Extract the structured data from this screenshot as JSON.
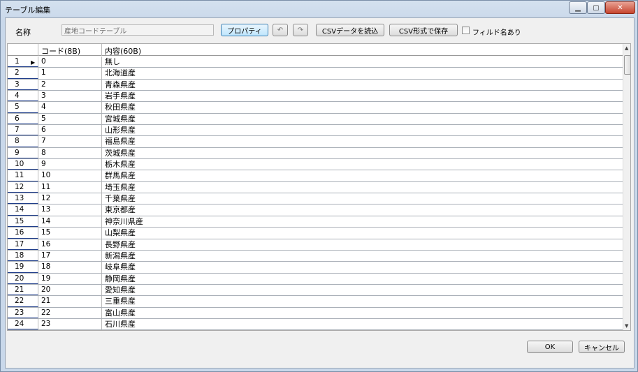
{
  "window": {
    "title": "テーブル編集"
  },
  "toolbar": {
    "name_label": "名称",
    "name_value": "産地コードテーブル",
    "property_label": "プロパティ",
    "undo_glyph": "↶",
    "redo_glyph": "↷",
    "csv_load_label": "CSVデータを読込",
    "csv_save_label": "CSV形式で保存",
    "field_names_label": "フィルド名あり",
    "field_names_checked": false
  },
  "grid": {
    "columns": [
      "コード(8B)",
      "内容(60B)"
    ],
    "rows": [
      {
        "num": "1",
        "code": "0",
        "content": "無し",
        "current": true
      },
      {
        "num": "2",
        "code": "1",
        "content": "北海道産"
      },
      {
        "num": "3",
        "code": "2",
        "content": "青森県産"
      },
      {
        "num": "4",
        "code": "3",
        "content": "岩手県産"
      },
      {
        "num": "5",
        "code": "4",
        "content": "秋田県産"
      },
      {
        "num": "6",
        "code": "5",
        "content": "宮城県産"
      },
      {
        "num": "7",
        "code": "6",
        "content": "山形県産"
      },
      {
        "num": "8",
        "code": "7",
        "content": "福島県産"
      },
      {
        "num": "9",
        "code": "8",
        "content": "茨城県産"
      },
      {
        "num": "10",
        "code": "9",
        "content": "栃木県産"
      },
      {
        "num": "11",
        "code": "10",
        "content": "群馬県産"
      },
      {
        "num": "12",
        "code": "11",
        "content": "埼玉県産"
      },
      {
        "num": "13",
        "code": "12",
        "content": "千葉県産"
      },
      {
        "num": "14",
        "code": "13",
        "content": "東京都産"
      },
      {
        "num": "15",
        "code": "14",
        "content": "神奈川県産"
      },
      {
        "num": "16",
        "code": "15",
        "content": "山梨県産"
      },
      {
        "num": "17",
        "code": "16",
        "content": "長野県産"
      },
      {
        "num": "18",
        "code": "17",
        "content": "新潟県産"
      },
      {
        "num": "19",
        "code": "18",
        "content": "岐阜県産"
      },
      {
        "num": "20",
        "code": "19",
        "content": "静岡県産"
      },
      {
        "num": "21",
        "code": "20",
        "content": "愛知県産"
      },
      {
        "num": "22",
        "code": "21",
        "content": "三重県産"
      },
      {
        "num": "23",
        "code": "22",
        "content": "富山県産"
      },
      {
        "num": "24",
        "code": "23",
        "content": "石川県産"
      }
    ]
  },
  "footer": {
    "ok_label": "OK",
    "cancel_label": "キャンセル"
  }
}
